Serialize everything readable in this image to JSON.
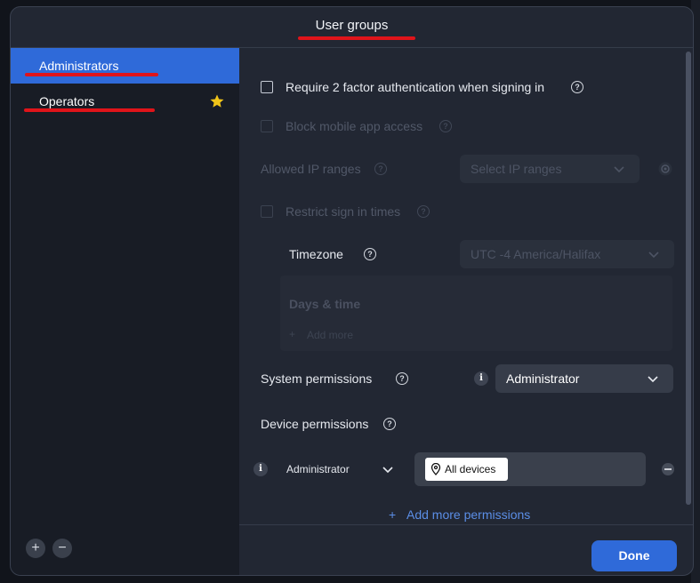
{
  "dialog": {
    "title": "User groups"
  },
  "sidebar": {
    "groups": [
      {
        "label": "Administrators",
        "selected": true
      },
      {
        "label": "Operators",
        "starred": true
      }
    ],
    "add_button": "+",
    "remove_button": "−"
  },
  "settings": {
    "require_2fa": {
      "label": "Require 2 factor authentication when signing in",
      "checked": false
    },
    "block_mobile": {
      "label": "Block mobile app access",
      "checked": false
    },
    "allowed_ip": {
      "label": "Allowed IP ranges",
      "placeholder": "Select IP ranges"
    },
    "restrict_times": {
      "label": "Restrict sign in times",
      "checked": false
    },
    "timezone": {
      "label": "Timezone",
      "value": "UTC -4 America/Halifax"
    },
    "days_time": {
      "title": "Days & time",
      "add_more": "Add more",
      "add_icon": "+"
    }
  },
  "system_permissions": {
    "label": "System permissions",
    "value": "Administrator"
  },
  "device_permissions": {
    "label": "Device permissions",
    "role": "Administrator",
    "scope_chip": "All devices"
  },
  "add_more_permissions": {
    "icon": "+",
    "label": "Add more permissions"
  },
  "footer": {
    "done_label": "Done"
  },
  "colors": {
    "accent": "#2f6ad9",
    "annotation_red": "#e0141a",
    "star": "#f0c419",
    "link": "#5b8ee6"
  },
  "icons": {
    "help": "question-circle",
    "info": "info-circle",
    "chevron": "chevron-down",
    "star": "star",
    "pin": "location-pin",
    "gear": "gear"
  }
}
